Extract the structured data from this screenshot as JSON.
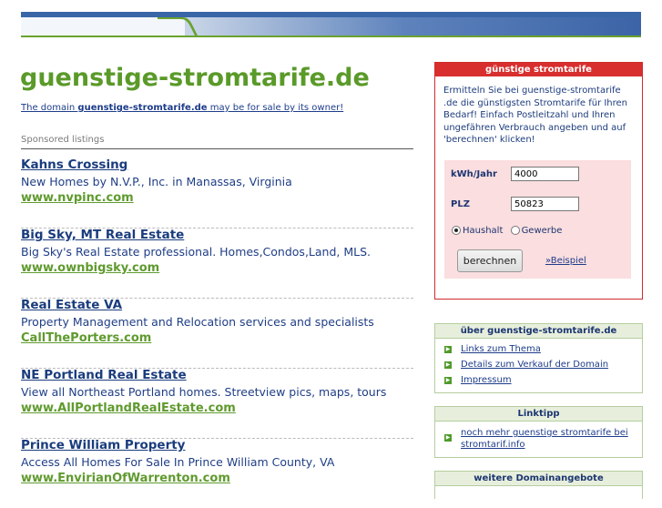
{
  "site": {
    "title": "guenstige-stromtarife.de",
    "sale_prefix": "The domain ",
    "sale_domain": "guenstige-stromtarife.de",
    "sale_suffix": " may be for sale by its owner!"
  },
  "sponsored": {
    "heading": "Sponsored listings",
    "listings": [
      {
        "title": "Kahns Crossing",
        "desc": "New Homes by N.V.P., Inc. in Manassas, Virginia",
        "url": "www.nvpinc.com"
      },
      {
        "title": "Big Sky, MT Real Estate",
        "desc": "Big Sky's Real Estate professional. Homes,Condos,Land, MLS.",
        "url": "www.ownbigsky.com"
      },
      {
        "title": "Real Estate VA",
        "desc": "Property Management and Relocation services and specialists",
        "url": "CallThePorters.com"
      },
      {
        "title": "NE Portland Real Estate",
        "desc": "View all Northeast Portland homes. Streetview pics, maps, tours",
        "url": "www.AllPortlandRealEstate.com"
      },
      {
        "title": "Prince William Property",
        "desc": "Access All Homes For Sale In Prince William County, VA",
        "url": "www.EnvirianOfWarrenton.com"
      }
    ]
  },
  "calculator": {
    "heading": "günstige stromtarife",
    "intro": "Ermitteln Sie bei guenstige-stromtarife .de die günstigsten Stromtarife für Ihren Bedarf! Einfach Postleitzahl und Ihren ungefähren Verbrauch angeben und auf 'berechnen' klicken!",
    "kwh_label": "kWh/Jahr",
    "kwh_value": "4000",
    "plz_label": "PLZ",
    "plz_value": "50823",
    "radio_household": "Haushalt",
    "radio_business": "Gewerbe",
    "selected": "Haushalt",
    "button": "berechnen",
    "example_link": "»Beispiel"
  },
  "about": {
    "heading": "über guenstige-stromtarife.de",
    "items": [
      "Links zum Thema",
      "Details zum Verkauf der Domain",
      "Impressum"
    ]
  },
  "linktipp": {
    "heading": "Linktipp",
    "item": "noch mehr guenstige stromtarife bei stromtarif.info"
  },
  "more": {
    "heading": "weitere Domainangebote"
  },
  "colors": {
    "brand_green": "#5a9a29",
    "link_blue": "#1d3c8a",
    "calc_red": "#d82e2e",
    "form_pink": "#fbdedf"
  }
}
